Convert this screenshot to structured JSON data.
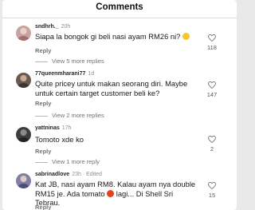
{
  "header": {
    "title": "Comments"
  },
  "comments": [
    {
      "username": "sndhrh._",
      "time": "20h",
      "edited": "",
      "text": "Siapa la bongok gi beli nasi ayam RM26 ni?",
      "emoji": "laugh-cry-emoji",
      "reply_label": "Reply",
      "view_more": "View 5 more replies",
      "likes": "118"
    },
    {
      "username": "77queenmharani77",
      "time": "1d",
      "edited": "",
      "text": "Quite pricey untuk makan seorang diri. Maybe untuk certain target customer beli ke?",
      "emoji": "",
      "reply_label": "Reply",
      "view_more": "View 2 more replies",
      "likes": "147"
    },
    {
      "username": "yattninas",
      "time": "17h",
      "edited": "",
      "text": "Tomoto xde ko",
      "emoji": "",
      "reply_label": "Reply",
      "view_more": "View 1 more reply",
      "likes": "2"
    },
    {
      "username": "sabrinadlove",
      "time": "23h",
      "edited": "· Edited",
      "text_part1": "Kat JB, nasi ayam RM8. Kalau ayam nya double RM15 je. Ada tomato ",
      "text_part2": " lagi... Di Shell Sri Tebrau.",
      "emoji": "tomato-emoji",
      "reply_label": "Reply",
      "view_more": "",
      "likes": "15"
    }
  ],
  "colors": {
    "avatar1": "#c9a3a3",
    "avatar2": "#6b5a52",
    "avatar3": "#3d3d3d",
    "avatar4": "#7f7fa8"
  }
}
